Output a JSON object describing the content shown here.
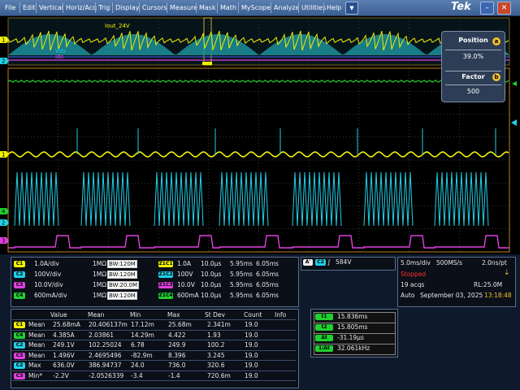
{
  "menu": {
    "items": [
      "File",
      "Edit",
      "Vertical",
      "Horiz/Acq",
      "Trig",
      "Display",
      "Cursors",
      "Measure",
      "Mask",
      "Math",
      "MyScope",
      "Analyze",
      "Utilities",
      "Help"
    ],
    "dropdown_glyph": "▼",
    "logo": "Tek",
    "minimize_glyph": "–",
    "close_glyph": "✕"
  },
  "waveform": {
    "zoom_label_iout": "Iout_24V",
    "zoom_label_vds": "Vds",
    "zoom_label_ids": "Ids",
    "markers": {
      "m1": "1",
      "m2": "2",
      "m3": "3",
      "m4": "4"
    },
    "colors": {
      "ch1": "#f0f000",
      "ch2": "#20d0e8",
      "ch3": "#e040e0",
      "ch4": "#20d030",
      "grid": "#6a6a6a",
      "zoom_bg": "#0d2c2f"
    }
  },
  "zoom_panel": {
    "position_title": "Position",
    "position_knob": "a",
    "position_value": "39.0%",
    "factor_title": "Factor",
    "factor_knob": "b",
    "factor_value": "500"
  },
  "channels": [
    {
      "badge": "C1",
      "scale": "1.0A/div",
      "imp": "1MΩ",
      "bw": "120M",
      "zbadge": "Z1C1",
      "zscale": "1.0A",
      "zt": "10.0µs",
      "t1": "5.95ms",
      "t2": "6.05ms",
      "color": "#f0f000"
    },
    {
      "badge": "C2",
      "scale": "100V/div",
      "imp": "1MΩ",
      "bw": "120M",
      "zbadge": "Z1C2",
      "zscale": "100V",
      "zt": "10.0µs",
      "t1": "5.95ms",
      "t2": "6.05ms",
      "color": "#20d0e8"
    },
    {
      "badge": "C3",
      "scale": "10.0V/div",
      "imp": "1MΩ",
      "bw": "20.0M",
      "zbadge": "Z1C3",
      "zscale": "10.0V",
      "zt": "10.0µs",
      "t1": "5.95ms",
      "t2": "6.05ms",
      "color": "#e040e0"
    },
    {
      "badge": "C4",
      "scale": "600mA/div",
      "imp": "1MΩ",
      "bw": "120M",
      "zbadge": "Z1C4",
      "zscale": "600mA",
      "zt": "10.0µs",
      "t1": "5.95ms",
      "t2": "6.05ms",
      "color": "#20d030"
    }
  ],
  "trigger": {
    "letter": "A'",
    "source": "C2",
    "level": "584V"
  },
  "acquisition": {
    "timebase": "5.0ms/div",
    "sample_rate": "500MS/s",
    "pt": "2.0ns/pt",
    "state": "Stopped",
    "acqs": "19 acqs",
    "record_length": "RL:25.0M",
    "mode": "Auto",
    "date": "September 03, 2025",
    "time": "13:18:48"
  },
  "measurements": {
    "headers": [
      "Value",
      "Mean",
      "Min",
      "Max",
      "St Dev",
      "Count",
      "Info"
    ],
    "rows": [
      {
        "badge": "C1",
        "color": "#f0f000",
        "type": "Mean",
        "value": "25.68mA",
        "mean": "20.406137m",
        "min": "17.12m",
        "max": "25.68m",
        "stdev": "2.341m",
        "count": "19.0"
      },
      {
        "badge": "C4",
        "color": "#20d030",
        "type": "Mean",
        "value": "4.385A",
        "mean": "2.03861",
        "min": "14.29m",
        "max": "4.422",
        "stdev": "1.93",
        "count": "19.0"
      },
      {
        "badge": "C2",
        "color": "#20d0e8",
        "type": "Mean",
        "value": "249.1V",
        "mean": "102.25024",
        "min": "6.78",
        "max": "249.9",
        "stdev": "100.2",
        "count": "19.0"
      },
      {
        "badge": "C3",
        "color": "#e040e0",
        "type": "Mean",
        "value": "1.496V",
        "mean": "2.4695496",
        "min": "-82.9m",
        "max": "8.396",
        "stdev": "3.245",
        "count": "19.0"
      },
      {
        "badge": "C2",
        "color": "#20d0e8",
        "type": "Max",
        "value": "636.0V",
        "mean": "386.94737",
        "min": "24.0",
        "max": "736.0",
        "stdev": "320.6",
        "count": "19.0"
      },
      {
        "badge": "C3",
        "color": "#e040e0",
        "type": "Min*",
        "value": "-2.2V",
        "mean": "-2.0526339",
        "min": "-3.4",
        "max": "-1.4",
        "stdev": "720.6m",
        "count": "19.0"
      }
    ]
  },
  "cursors": [
    {
      "label": "t1",
      "value": "15.836ms"
    },
    {
      "label": "t2",
      "value": "15.805ms"
    },
    {
      "label": "Δt",
      "value": "-31.19µs"
    },
    {
      "label": "1/Δt",
      "value": "32.061kHz"
    }
  ]
}
